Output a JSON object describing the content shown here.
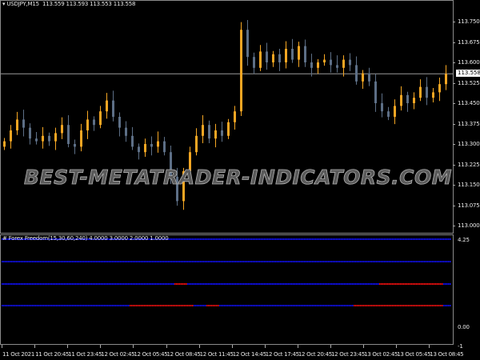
{
  "symbol_header": {
    "title": "USDJPY,M15",
    "open": "113.559",
    "high": "113.593",
    "low": "113.553",
    "close": "113.558"
  },
  "indicator_header": "# Forex Freedom(15,30,60,240) 4.0000 3.0000 2.0000 1.0000",
  "current_price": "113.558",
  "watermark": "BEST-METATRADER-INDICATORS.COM",
  "colors": {
    "bull": "#f5a623",
    "bear": "#5d6f86",
    "neutral": "#3a9a3a",
    "blue": "#1010ff",
    "red": "#ff1010",
    "grid": "#8a8a8a"
  },
  "price_axis": {
    "min": 113.0,
    "max": 113.75,
    "labels": [
      "113.750",
      "113.675",
      "113.600",
      "113.525",
      "113.450",
      "113.375",
      "113.300",
      "113.225",
      "113.150",
      "113.075",
      "113.000"
    ]
  },
  "sub_axis": {
    "labels": [
      "4.25",
      "0.00",
      "-1"
    ]
  },
  "time_axis": [
    "11 Oct 2021",
    "11 Oct 20:45",
    "11 Oct 23:45",
    "12 Oct 02:45",
    "12 Oct 05:45",
    "12 Oct 08:45",
    "12 Oct 11:45",
    "12 Oct 14:45",
    "12 Oct 17:45",
    "12 Oct 20:45",
    "12 Oct 23:45",
    "13 Oct 02:45",
    "13 Oct 05:45",
    "13 Oct 08:45"
  ],
  "chart_data": {
    "type": "candlestick",
    "closes": [
      113.31,
      113.35,
      113.39,
      113.36,
      113.32,
      113.31,
      113.33,
      113.31,
      113.34,
      113.37,
      113.3,
      113.29,
      113.35,
      113.39,
      113.37,
      113.42,
      113.46,
      113.4,
      113.36,
      113.33,
      113.29,
      113.27,
      113.3,
      113.29,
      113.31,
      113.27,
      113.18,
      113.09,
      113.2,
      113.27,
      113.33,
      113.37,
      113.32,
      113.35,
      113.33,
      113.38,
      113.42,
      113.72,
      113.62,
      113.58,
      113.64,
      113.6,
      113.63,
      113.6,
      113.65,
      113.61,
      113.66,
      113.6,
      113.58,
      113.6,
      113.61,
      113.59,
      113.58,
      113.61,
      113.59,
      113.53,
      113.56,
      113.53,
      113.45,
      113.42,
      113.4,
      113.44,
      113.48,
      113.45,
      113.47,
      113.51,
      113.47,
      113.49,
      113.52,
      113.558
    ],
    "indicator_levels": [
      {
        "level": 4,
        "red_bars": []
      },
      {
        "level": 3,
        "red_bars": []
      },
      {
        "level": 2,
        "red_bars": [
          [
            27,
            28
          ],
          [
            59,
            65
          ],
          [
            66,
            68
          ]
        ]
      },
      {
        "level": 1,
        "red_bars": [
          [
            20,
            29
          ],
          [
            32,
            33
          ],
          [
            55,
            68
          ]
        ]
      }
    ]
  }
}
